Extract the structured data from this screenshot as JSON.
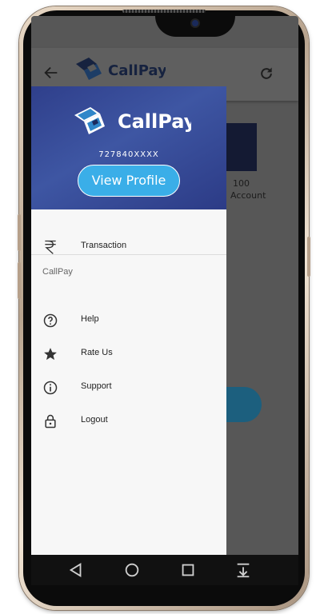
{
  "app": {
    "brand_name": "CallPay"
  },
  "drawer": {
    "phone_number": "727840XXXX",
    "view_profile_label": "View Profile",
    "primary_items": [
      {
        "label": "Transaction",
        "icon": "rupee-icon"
      }
    ],
    "section_title": "CallPay",
    "section_items": [
      {
        "label": "Help",
        "icon": "help-circle-icon"
      },
      {
        "label": "Rate Us",
        "icon": "star-icon"
      },
      {
        "label": "Support",
        "icon": "info-icon"
      },
      {
        "label": "Logout",
        "icon": "lock-icon"
      }
    ]
  },
  "background": {
    "text_line1": "100",
    "text_line2": "Account"
  },
  "colors": {
    "drawer_header": "#3e56a3",
    "button": "#3aaee8",
    "logo_dark": "#1b2a5e",
    "logo_blue": "#2f86c9"
  }
}
